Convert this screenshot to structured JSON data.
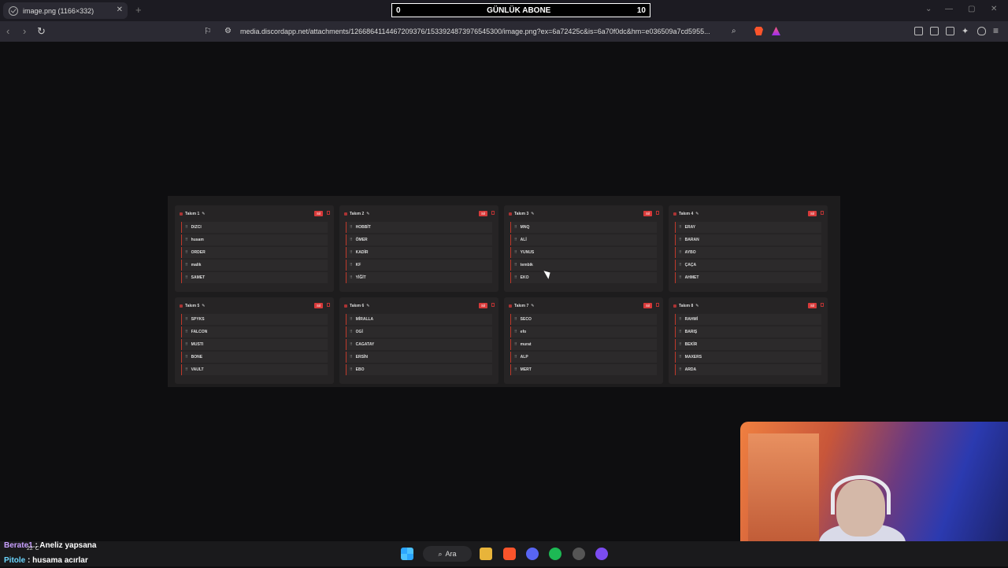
{
  "browser": {
    "tab_title": "image.png (1166×332)",
    "close_glyph": "✕",
    "new_tab_glyph": "+",
    "url": "media.discordapp.net/attachments/1266864114467209376/1533924873976545300/image.png?ex=6a72425c&is=6a70f0dc&hm=e036509a7cd5955...",
    "icons": [
      "back-icon",
      "forward-icon",
      "reload-icon",
      "bookmark-icon",
      "site-info-icon",
      "zoom-icon",
      "brave-shield-icon",
      "rewards-icon",
      "extensions-icon",
      "sidebar-icon",
      "wallet-icon",
      "leo-icon",
      "vpn-icon",
      "menu-icon"
    ]
  },
  "overlay": {
    "left": "0",
    "title": "GÜNLÜK ABONE",
    "right": "10"
  },
  "teams": [
    {
      "name": "Takım 1",
      "delete": "Sil",
      "members": [
        "DIZCI",
        "husam",
        "ORDER",
        "malik",
        "SAMET"
      ]
    },
    {
      "name": "Takım 2",
      "delete": "Sil",
      "members": [
        "HOBBİT",
        "ÖMER",
        "KADİR",
        "KF",
        "YİĞİT"
      ]
    },
    {
      "name": "Takım 3",
      "delete": "Sil",
      "members": [
        "MNQ",
        "ALİ",
        "YUNUS",
        "tembik",
        "EKO"
      ]
    },
    {
      "name": "Takım 4",
      "delete": "Sil",
      "members": [
        "ERAY",
        "BARAN",
        "AYBO",
        "ÇAÇA",
        "AHMET"
      ]
    },
    {
      "name": "Takım 5",
      "delete": "Sil",
      "members": [
        "SPYKS",
        "FALCON",
        "MUSTI",
        "BONE",
        "VAULT"
      ]
    },
    {
      "name": "Takım 6",
      "delete": "Sil",
      "members": [
        "MİRALLA",
        "OGİ",
        "CAGATAY",
        "ERSİN",
        "EBO"
      ]
    },
    {
      "name": "Takım 7",
      "delete": "Sil",
      "members": [
        "SECO",
        "efo",
        "murat",
        "ALP",
        "MERT"
      ]
    },
    {
      "name": "Takım 8",
      "delete": "Sil",
      "members": [
        "RAHMİ",
        "BARIŞ",
        "BEKİR",
        "MAXERS",
        "ARDA"
      ]
    }
  ],
  "chat": [
    {
      "user": "Berate1",
      "sep": " : ",
      "message": "Aneliz yapsana"
    },
    {
      "user": "Pitole",
      "sep": " : ",
      "message": "husama acırlar"
    }
  ],
  "weather": "22°C",
  "taskbar": {
    "search_label": "Ara"
  }
}
